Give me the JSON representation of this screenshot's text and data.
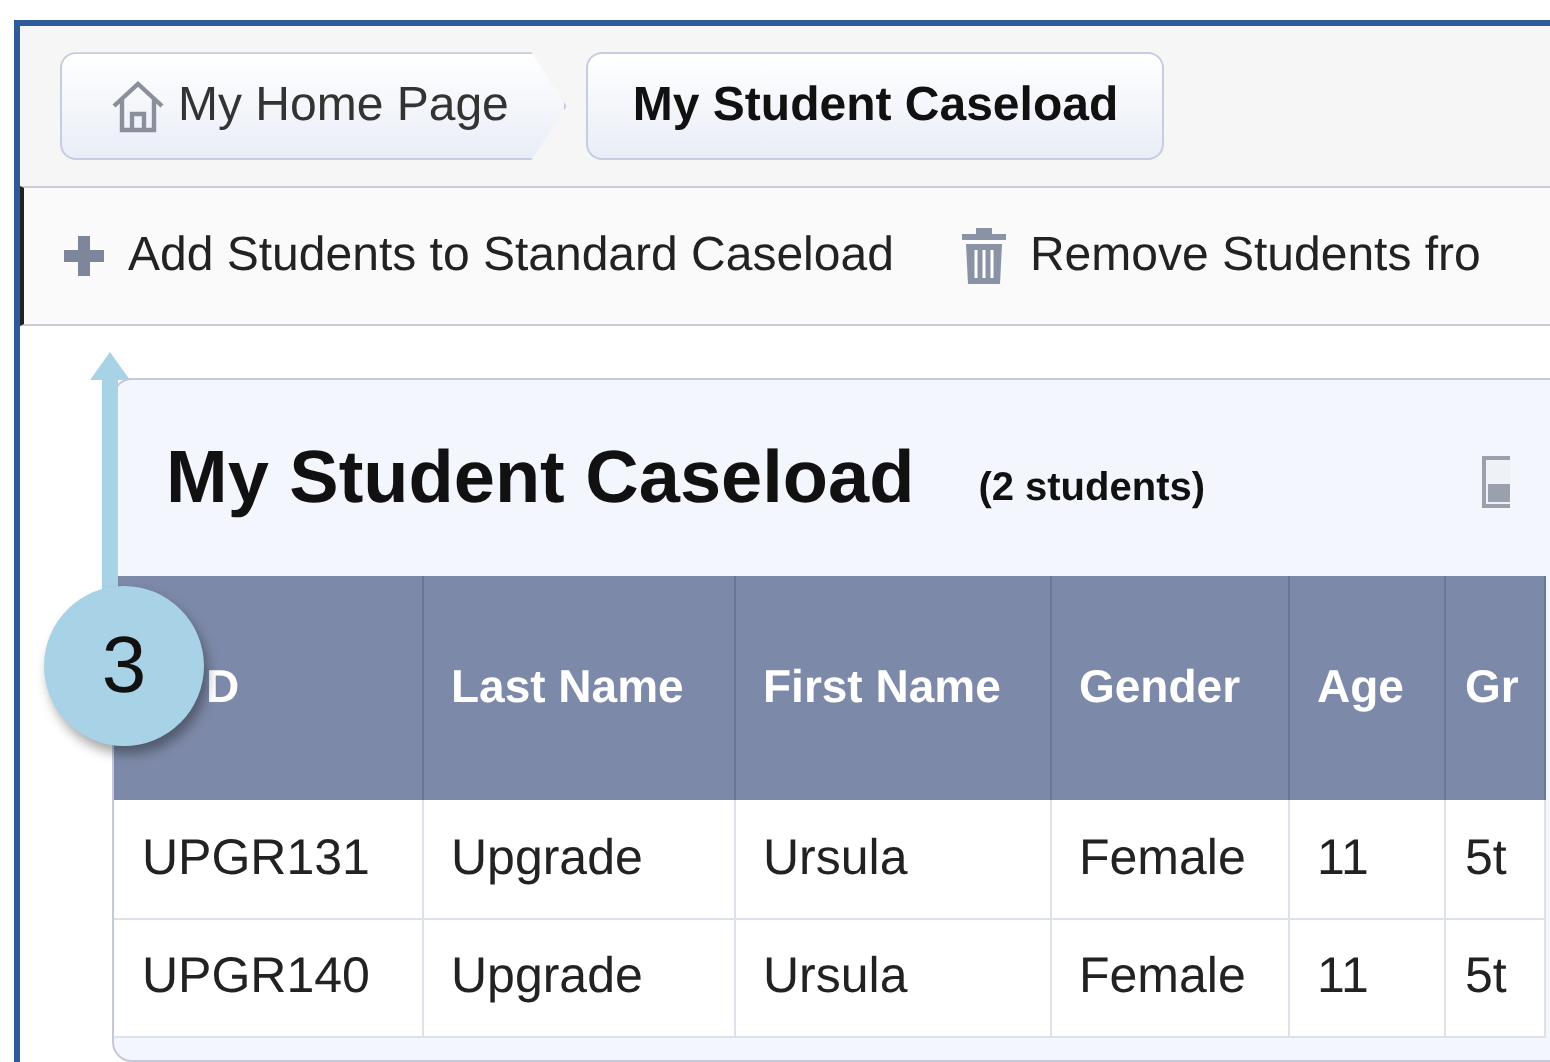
{
  "breadcrumbs": [
    {
      "label": "My Home Page",
      "kind": "home",
      "selected": false
    },
    {
      "label": "My Student Caseload",
      "kind": "page",
      "selected": true
    }
  ],
  "toolbar": [
    {
      "label": "Add Students to Standard Caseload",
      "kind": "add"
    },
    {
      "label": "Remove Students fro",
      "kind": "remove"
    }
  ],
  "card": {
    "title": "My Student Caseload",
    "count": "(2 students)"
  },
  "table": {
    "columns": [
      "D",
      "Last Name",
      "First Name",
      "Gender",
      "Age",
      "Gr"
    ],
    "rows": [
      [
        "UPGR131",
        "Upgrade",
        "Ursula",
        "Female",
        "11",
        "5t"
      ],
      [
        "UPGR140",
        "Upgrade",
        "Ursula",
        "Female",
        "11",
        "5t"
      ]
    ]
  },
  "callout": {
    "label": "3"
  }
}
